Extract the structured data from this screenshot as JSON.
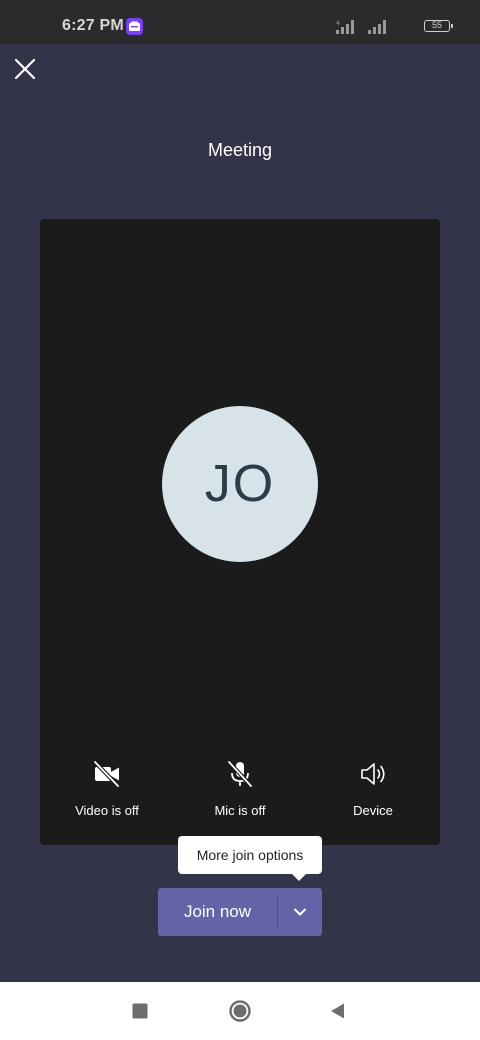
{
  "status_bar": {
    "time": "6:27 PM",
    "battery": "55"
  },
  "header": {
    "title": "Meeting"
  },
  "preview": {
    "initials": "JO"
  },
  "controls": {
    "video_label": "Video is off",
    "mic_label": "Mic is off",
    "device_label": "Device"
  },
  "join": {
    "tooltip": "More join options",
    "join_label": "Join now"
  },
  "icons": {
    "close": "close-icon",
    "video": "video-off-icon",
    "mic": "mic-off-icon",
    "device": "speaker-icon",
    "options": "chevron-down-icon"
  },
  "colors": {
    "background": "#33344a",
    "preview": "#1b1b1b",
    "accent": "#6264a7",
    "avatar": "#d7e3e9"
  }
}
